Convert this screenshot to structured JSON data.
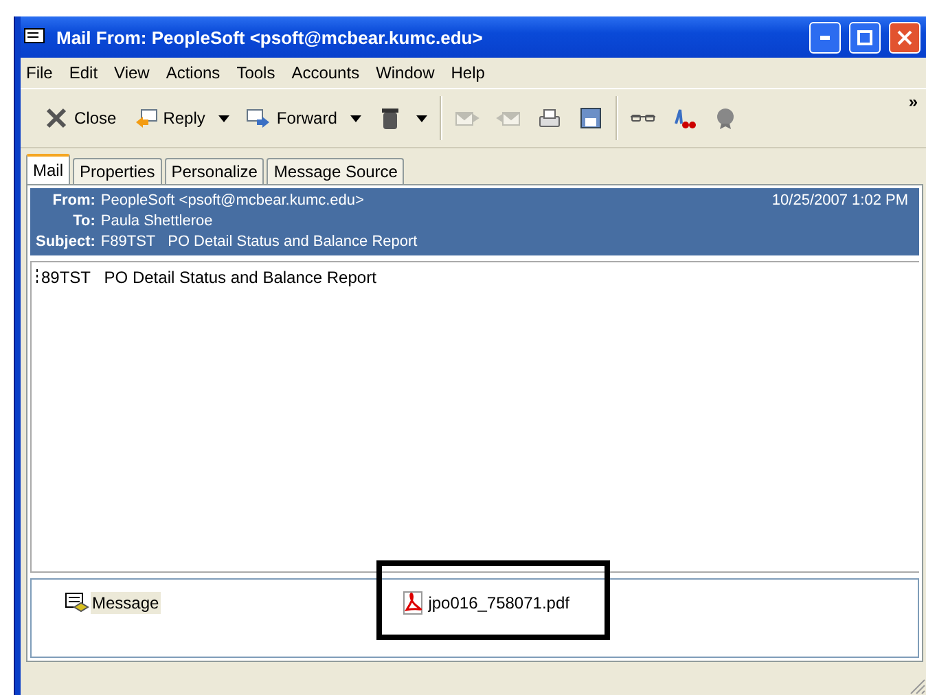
{
  "window": {
    "title": "Mail From: PeopleSoft <psoft@mcbear.kumc.edu>"
  },
  "menu": [
    "File",
    "Edit",
    "View",
    "Actions",
    "Tools",
    "Accounts",
    "Window",
    "Help"
  ],
  "toolbar": [
    {
      "kind": "labeled",
      "label": "Close",
      "disabled": false
    },
    {
      "kind": "labeled",
      "label": "Reply",
      "dropdown": true,
      "disabled": false
    },
    {
      "kind": "labeled",
      "label": "Forward",
      "dropdown": true,
      "disabled": false
    },
    {
      "kind": "icon",
      "dropdown": true,
      "disabled": false
    },
    {
      "kind": "separator"
    },
    {
      "kind": "icon",
      "disabled": true
    },
    {
      "kind": "icon",
      "disabled": true
    },
    {
      "kind": "icon",
      "disabled": false
    },
    {
      "kind": "icon",
      "disabled": false
    },
    {
      "kind": "separator"
    },
    {
      "kind": "icon",
      "disabled": false
    },
    {
      "kind": "icon",
      "disabled": false
    },
    {
      "kind": "icon",
      "disabled": false
    }
  ],
  "toolbar_overflow": "»",
  "tabs": [
    {
      "label": "Mail",
      "selected": true
    },
    {
      "label": "Properties",
      "selected": false
    },
    {
      "label": "Personalize",
      "selected": false
    },
    {
      "label": "Message Source",
      "selected": false
    }
  ],
  "header": {
    "fields": [
      {
        "label": "From:",
        "value": "PeopleSoft <psoft@mcbear.kumc.edu>"
      },
      {
        "label": "To:",
        "value": "Paula Shettleroe"
      },
      {
        "label": "Subject:",
        "value": "F89TST   PO Detail Status and Balance Report"
      }
    ],
    "date": "10/25/2007 1:02 PM"
  },
  "body": "89TST   PO Detail Status and Balance Report",
  "attachments": [
    {
      "kind": "message",
      "name": "Message",
      "selected": true
    },
    {
      "kind": "pdf",
      "name": "jpo016_758071.pdf",
      "selected": false,
      "highlighted": true
    }
  ]
}
